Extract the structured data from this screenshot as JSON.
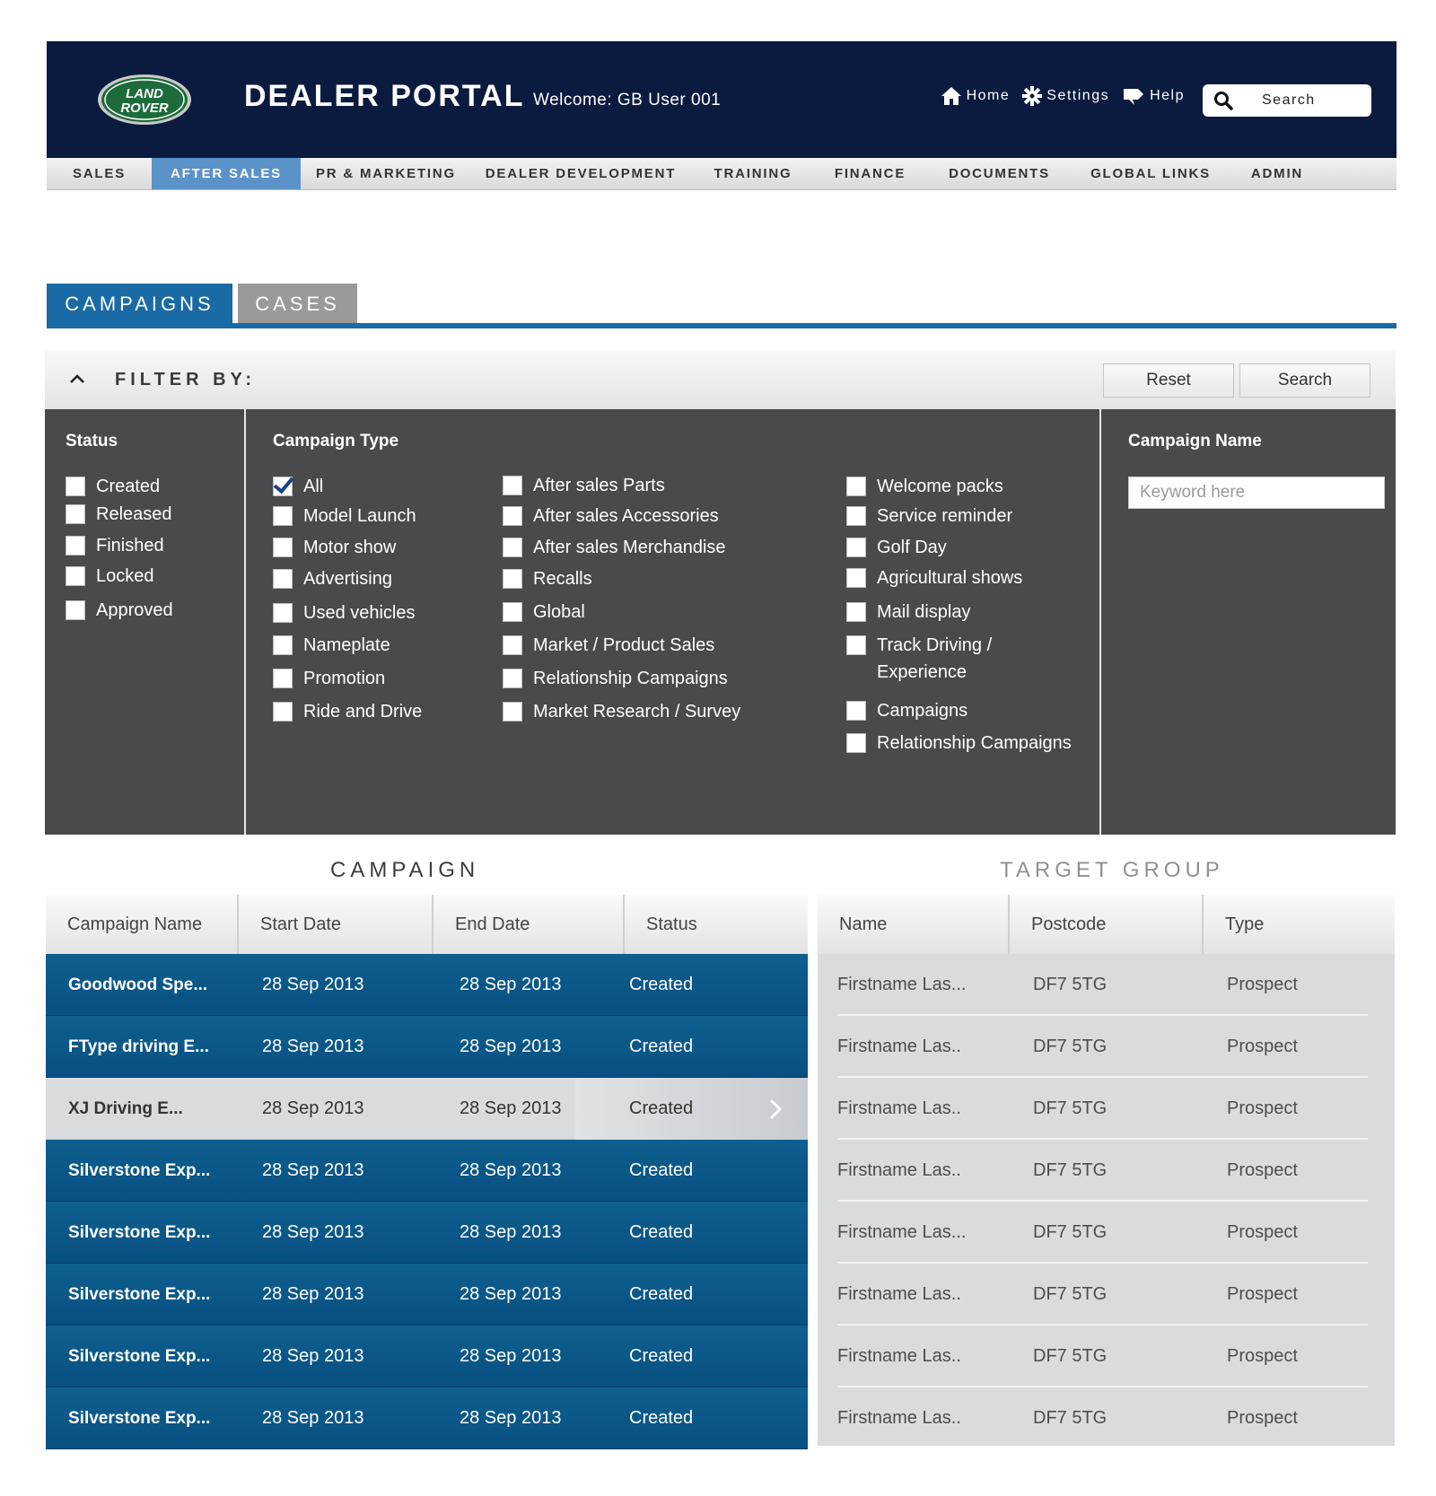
{
  "header": {
    "logo_text_line1": "LAND",
    "logo_text_line2": "ROVER",
    "title": "DEALER PORTAL",
    "welcome": "Welcome: GB User 001",
    "links": {
      "home": "Home",
      "settings": "Settings",
      "help": "Help"
    },
    "search_label": "Search"
  },
  "nav": {
    "items": [
      {
        "label": "SALES",
        "active": false
      },
      {
        "label": "AFTER SALES",
        "active": true
      },
      {
        "label": "PR & MARKETING",
        "active": false
      },
      {
        "label": "DEALER DEVELOPMENT",
        "active": false
      },
      {
        "label": "TRAINING",
        "active": false
      },
      {
        "label": "FINANCE",
        "active": false
      },
      {
        "label": "DOCUMENTS",
        "active": false
      },
      {
        "label": "GLOBAL LINKS",
        "active": false
      },
      {
        "label": "ADMIN",
        "active": false
      }
    ]
  },
  "tabs": {
    "campaigns": "CAMPAIGNS",
    "cases": "CASES"
  },
  "filter": {
    "label": "FILTER BY:",
    "reset": "Reset",
    "search": "Search",
    "status": {
      "title": "Status",
      "options": [
        "Created",
        "Released",
        "Finished",
        "Locked",
        "Approved"
      ]
    },
    "campaign_type": {
      "title": "Campaign Type",
      "col1": [
        "All",
        "Model Launch",
        "Motor show",
        "Advertising",
        "Used vehicles",
        "Nameplate",
        "Promotion",
        "Ride and Drive"
      ],
      "col2": [
        "After sales Parts",
        "After sales Accessories",
        "After sales Merchandise",
        "Recalls",
        "Global",
        "Market / Product Sales",
        "Relationship Campaigns",
        "Market Research / Survey"
      ],
      "col3": [
        "Welcome packs",
        "Service reminder",
        "Golf Day",
        "Agricultural shows",
        "Mail display",
        "Track Driving /",
        "Experience",
        "Campaigns",
        "Relationship Campaigns"
      ]
    },
    "campaign_name": {
      "title": "Campaign Name",
      "placeholder": "Keyword here"
    }
  },
  "campaign_table": {
    "title": "CAMPAIGN",
    "columns": [
      "Campaign Name",
      "Start Date",
      "End Date",
      "Status"
    ],
    "rows": [
      [
        "Goodwood Spe...",
        "28 Sep 2013",
        "28 Sep 2013",
        "Created"
      ],
      [
        "FType driving E...",
        "28 Sep 2013",
        "28 Sep 2013",
        "Created"
      ],
      [
        "XJ Driving E...",
        "28 Sep 2013",
        "28 Sep 2013",
        "Created"
      ],
      [
        "Silverstone Exp...",
        "28 Sep 2013",
        "28 Sep 2013",
        "Created"
      ],
      [
        "Silverstone Exp...",
        "28 Sep 2013",
        "28 Sep 2013",
        "Created"
      ],
      [
        "Silverstone Exp...",
        "28 Sep 2013",
        "28 Sep 2013",
        "Created"
      ],
      [
        "Silverstone Exp...",
        "28 Sep 2013",
        "28 Sep 2013",
        "Created"
      ],
      [
        "Silverstone Exp...",
        "28 Sep 2013",
        "28 Sep 2013",
        "Created"
      ]
    ],
    "selected_row": 2
  },
  "target_table": {
    "title": "TARGET GROUP",
    "columns": [
      "Name",
      "Postcode",
      "Type"
    ],
    "rows": [
      [
        "Firstname Las...",
        "DF7 5TG",
        "Prospect"
      ],
      [
        "Firstname Las..",
        "DF7 5TG",
        "Prospect"
      ],
      [
        "Firstname Las..",
        "DF7 5TG",
        "Prospect"
      ],
      [
        "Firstname Las..",
        "DF7 5TG",
        "Prospect"
      ],
      [
        "Firstname Las...",
        "DF7 5TG",
        "Prospect"
      ],
      [
        "Firstname Las..",
        "DF7 5TG",
        "Prospect"
      ],
      [
        "Firstname Las..",
        "DF7 5TG",
        "Prospect"
      ],
      [
        "Firstname Las..",
        "DF7 5TG",
        "Prospect"
      ]
    ]
  },
  "colors": {
    "header_bg": "#0b1b3f",
    "accent_blue": "#1a6aa6",
    "nav_active": "#5b93c9",
    "panel_bg": "#4a4a4c",
    "row_blue": "#075081",
    "row_selected": "#d9dcdf"
  },
  "icons": [
    "land-rover-logo",
    "home-icon",
    "settings-icon",
    "help-icon",
    "search-icon",
    "chevron-up-icon",
    "chevron-right-icon",
    "checkbox-icon"
  ]
}
